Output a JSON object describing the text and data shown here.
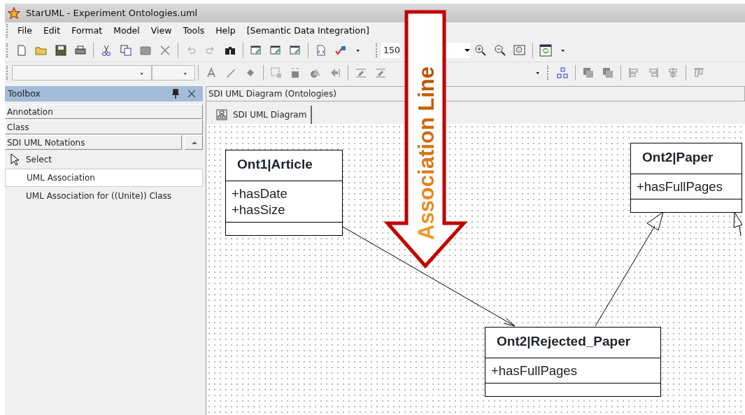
{
  "window": {
    "title": "StarUML - Experiment Ontologies.uml"
  },
  "menu": [
    {
      "label": "File"
    },
    {
      "label": "Edit"
    },
    {
      "label": "Format"
    },
    {
      "label": "Model"
    },
    {
      "label": "View"
    },
    {
      "label": "Tools"
    },
    {
      "label": "Help"
    },
    {
      "label": "[Semantic Data Integration]"
    }
  ],
  "zoom": {
    "value": "150"
  },
  "toolbox": {
    "title": "Toolbox",
    "sections": [
      {
        "label": "Annotation",
        "expanded": false
      },
      {
        "label": "Class",
        "expanded": false
      },
      {
        "label": "SDI UML Notations",
        "expanded": true
      }
    ],
    "items": [
      {
        "label": "Select",
        "kind": "pointer",
        "selected": false
      },
      {
        "label": "UML Association",
        "kind": "tool",
        "selected": true
      },
      {
        "label": "UML Association for ((Unite)) Class",
        "kind": "tool",
        "selected": false
      }
    ]
  },
  "document": {
    "title": "SDI UML Diagram (Ontologies)",
    "tab": "SDI UML Diagram"
  },
  "diagram": {
    "classes": [
      {
        "name": "Ont1|Article",
        "attributes": [
          "+hasDate",
          "+hasSize"
        ]
      },
      {
        "name": "Ont2|Paper",
        "attributes": [
          "+hasFullPages"
        ]
      },
      {
        "name": "Ont2|Rejected_Paper",
        "attributes": [
          "+hasFullPages"
        ]
      }
    ]
  },
  "annotation": {
    "label": "Association Line"
  }
}
